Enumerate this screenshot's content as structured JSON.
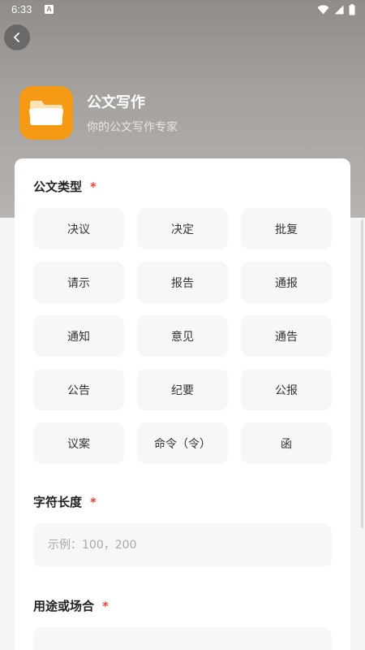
{
  "status_bar": {
    "time": "6:33",
    "notification_icon": "A"
  },
  "header": {
    "title": "公文写作",
    "subtitle": "你的公文写作专家"
  },
  "form": {
    "type_section": {
      "label": "公文类型",
      "required_mark": "*",
      "options": [
        "决议",
        "决定",
        "批复",
        "请示",
        "报告",
        "通报",
        "通知",
        "意见",
        "通告",
        "公告",
        "纪要",
        "公报",
        "议案",
        "命令（令）",
        "函"
      ]
    },
    "length_section": {
      "label": "字符长度",
      "required_mark": "*",
      "placeholder": "示例：100，200"
    },
    "purpose_section": {
      "label": "用途或场合",
      "required_mark": "*"
    }
  },
  "colors": {
    "accent_required": "#e8483b",
    "app_icon": "#f59a15"
  }
}
